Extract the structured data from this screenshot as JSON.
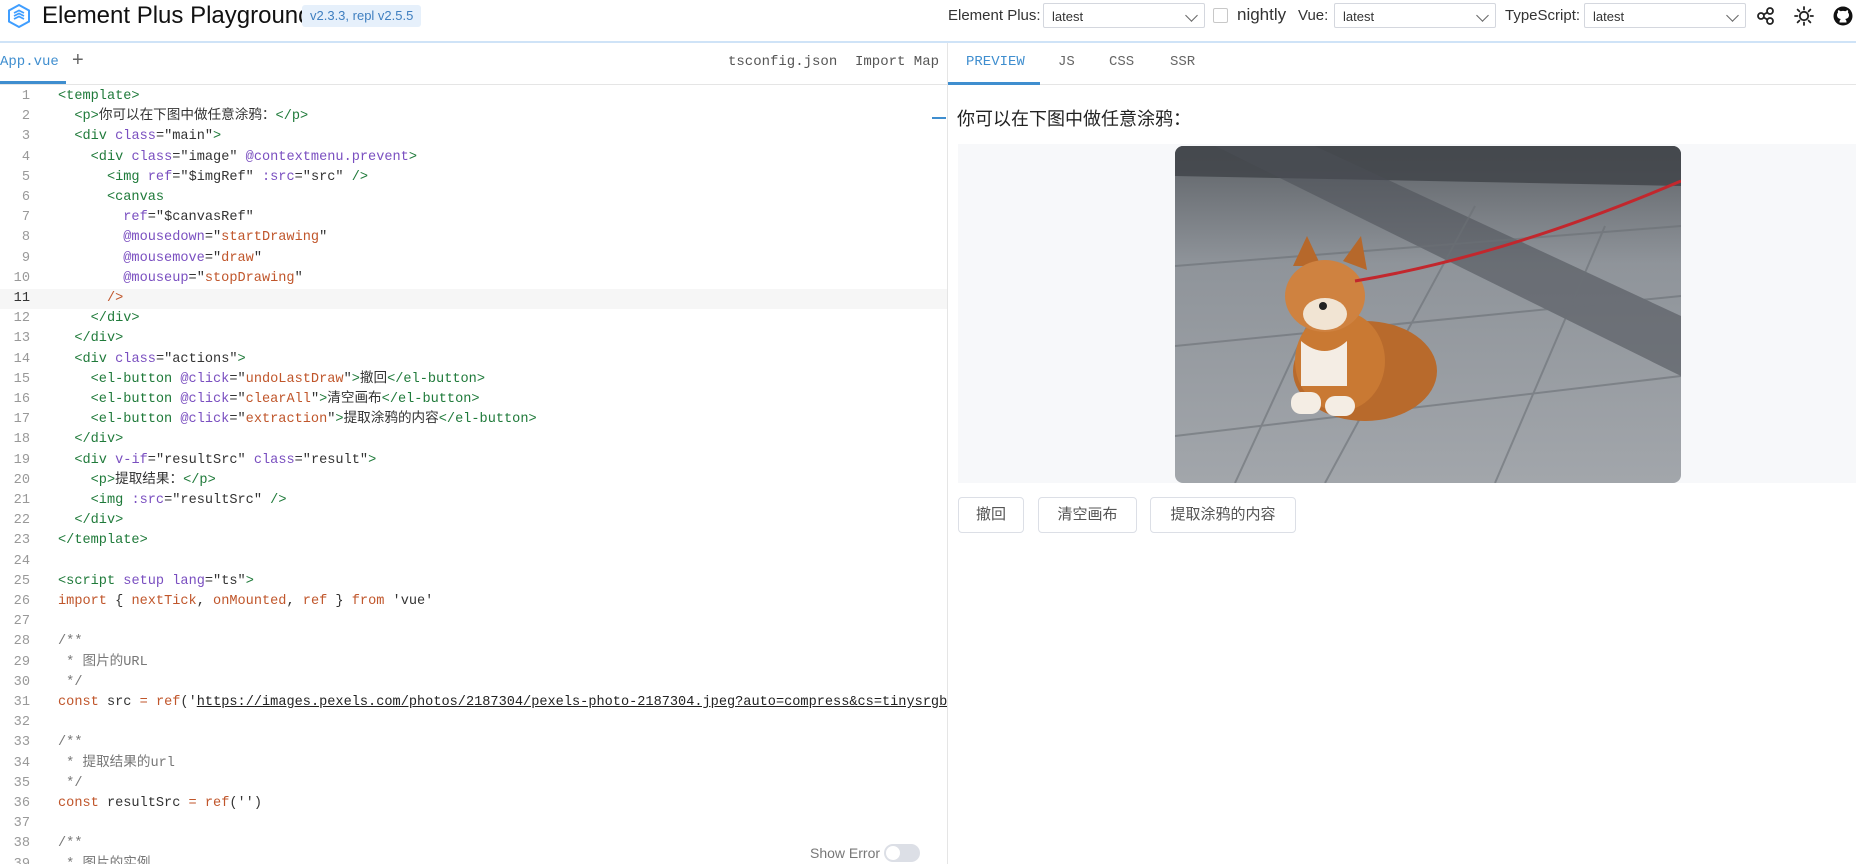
{
  "header": {
    "title": "Element Plus Playground",
    "version_badge": "v2.3.3, repl v2.5.5",
    "element_plus_label": "Element Plus:",
    "element_plus_value": "latest",
    "nightly_label": "nightly",
    "vue_label": "Vue:",
    "vue_value": "latest",
    "typescript_label": "TypeScript:",
    "typescript_value": "latest",
    "icons": [
      "share-icon",
      "sun-icon",
      "github-icon"
    ]
  },
  "editor_tabs": {
    "active": "App.vue",
    "add": "+",
    "right": [
      "tsconfig.json",
      "Import Map"
    ]
  },
  "preview_tabs": [
    "PREVIEW",
    "JS",
    "CSS",
    "SSR"
  ],
  "editor": {
    "active_line": 11,
    "lines": [
      {
        "n": "1",
        "segs": [
          [
            "tag",
            "<template>"
          ]
        ]
      },
      {
        "n": "2",
        "segs": [
          [
            "txt",
            "  "
          ],
          [
            "tag",
            "<p>"
          ],
          [
            "txt",
            "你可以在下图中做任意涂鸦："
          ],
          [
            "tag",
            "</p>"
          ]
        ]
      },
      {
        "n": "3",
        "segs": [
          [
            "txt",
            "  "
          ],
          [
            "tag",
            "<div"
          ],
          [
            "txt",
            " "
          ],
          [
            "attr",
            "class"
          ],
          [
            "txt",
            "=\"main\""
          ],
          [
            "tag",
            ">"
          ]
        ]
      },
      {
        "n": "4",
        "segs": [
          [
            "txt",
            "    "
          ],
          [
            "tag",
            "<div"
          ],
          [
            "txt",
            " "
          ],
          [
            "attr",
            "class"
          ],
          [
            "txt",
            "=\"image\" "
          ],
          [
            "attr",
            "@contextmenu.prevent"
          ],
          [
            "tag",
            ">"
          ]
        ]
      },
      {
        "n": "5",
        "segs": [
          [
            "txt",
            "      "
          ],
          [
            "tag",
            "<img"
          ],
          [
            "txt",
            " "
          ],
          [
            "attr",
            "ref"
          ],
          [
            "txt",
            "=\"$imgRef\" "
          ],
          [
            "attr",
            ":src"
          ],
          [
            "txt",
            "=\"src\" "
          ],
          [
            "tag",
            "/>"
          ]
        ]
      },
      {
        "n": "6",
        "segs": [
          [
            "txt",
            "      "
          ],
          [
            "tag",
            "<canvas"
          ]
        ]
      },
      {
        "n": "7",
        "segs": [
          [
            "txt",
            "        "
          ],
          [
            "attr",
            "ref"
          ],
          [
            "txt",
            "=\"$canvasRef\""
          ]
        ]
      },
      {
        "n": "8",
        "segs": [
          [
            "txt",
            "        "
          ],
          [
            "attr",
            "@mousedown"
          ],
          [
            "txt",
            "=\""
          ],
          [
            "str",
            "startDrawing"
          ],
          [
            "txt",
            "\""
          ]
        ]
      },
      {
        "n": "9",
        "segs": [
          [
            "txt",
            "        "
          ],
          [
            "attr",
            "@mousemove"
          ],
          [
            "txt",
            "=\""
          ],
          [
            "str",
            "draw"
          ],
          [
            "txt",
            "\""
          ]
        ]
      },
      {
        "n": "10",
        "segs": [
          [
            "txt",
            "        "
          ],
          [
            "attr",
            "@mouseup"
          ],
          [
            "txt",
            "=\""
          ],
          [
            "str",
            "stopDrawing"
          ],
          [
            "txt",
            "\""
          ]
        ]
      },
      {
        "n": "11",
        "segs": [
          [
            "txt",
            "      "
          ],
          [
            "str",
            "/>"
          ]
        ]
      },
      {
        "n": "12",
        "segs": [
          [
            "txt",
            "    "
          ],
          [
            "tag",
            "</div>"
          ]
        ]
      },
      {
        "n": "13",
        "segs": [
          [
            "txt",
            "  "
          ],
          [
            "tag",
            "</div>"
          ]
        ]
      },
      {
        "n": "14",
        "segs": [
          [
            "txt",
            "  "
          ],
          [
            "tag",
            "<div"
          ],
          [
            "txt",
            " "
          ],
          [
            "attr",
            "class"
          ],
          [
            "txt",
            "=\"actions\""
          ],
          [
            "tag",
            ">"
          ]
        ]
      },
      {
        "n": "15",
        "segs": [
          [
            "txt",
            "    "
          ],
          [
            "tag",
            "<el-button"
          ],
          [
            "txt",
            " "
          ],
          [
            "attr",
            "@click"
          ],
          [
            "txt",
            "=\""
          ],
          [
            "str",
            "undoLastDraw"
          ],
          [
            "txt",
            "\""
          ],
          [
            "tag",
            ">"
          ],
          [
            "txt",
            "撤回"
          ],
          [
            "tag",
            "</el-button>"
          ]
        ]
      },
      {
        "n": "16",
        "segs": [
          [
            "txt",
            "    "
          ],
          [
            "tag",
            "<el-button"
          ],
          [
            "txt",
            " "
          ],
          [
            "attr",
            "@click"
          ],
          [
            "txt",
            "=\""
          ],
          [
            "str",
            "clearAll"
          ],
          [
            "txt",
            "\""
          ],
          [
            "tag",
            ">"
          ],
          [
            "txt",
            "清空画布"
          ],
          [
            "tag",
            "</el-button>"
          ]
        ]
      },
      {
        "n": "17",
        "segs": [
          [
            "txt",
            "    "
          ],
          [
            "tag",
            "<el-button"
          ],
          [
            "txt",
            " "
          ],
          [
            "attr",
            "@click"
          ],
          [
            "txt",
            "=\""
          ],
          [
            "str",
            "extraction"
          ],
          [
            "txt",
            "\""
          ],
          [
            "tag",
            ">"
          ],
          [
            "txt",
            "提取涂鸦的内容"
          ],
          [
            "tag",
            "</el-button>"
          ]
        ]
      },
      {
        "n": "18",
        "segs": [
          [
            "txt",
            "  "
          ],
          [
            "tag",
            "</div>"
          ]
        ]
      },
      {
        "n": "19",
        "segs": [
          [
            "txt",
            "  "
          ],
          [
            "tag",
            "<div"
          ],
          [
            "txt",
            " "
          ],
          [
            "attr",
            "v-if"
          ],
          [
            "txt",
            "=\"resultSrc\" "
          ],
          [
            "attr",
            "class"
          ],
          [
            "txt",
            "=\"result\""
          ],
          [
            "tag",
            ">"
          ]
        ]
      },
      {
        "n": "20",
        "segs": [
          [
            "txt",
            "    "
          ],
          [
            "tag",
            "<p>"
          ],
          [
            "txt",
            "提取结果："
          ],
          [
            "tag",
            "</p>"
          ]
        ]
      },
      {
        "n": "21",
        "segs": [
          [
            "txt",
            "    "
          ],
          [
            "tag",
            "<img"
          ],
          [
            "txt",
            " "
          ],
          [
            "attr",
            ":src"
          ],
          [
            "txt",
            "=\"resultSrc\" "
          ],
          [
            "tag",
            "/>"
          ]
        ]
      },
      {
        "n": "22",
        "segs": [
          [
            "txt",
            "  "
          ],
          [
            "tag",
            "</div>"
          ]
        ]
      },
      {
        "n": "23",
        "segs": [
          [
            "tag",
            "</template>"
          ]
        ]
      },
      {
        "n": "24",
        "segs": []
      },
      {
        "n": "25",
        "segs": [
          [
            "tag",
            "<script"
          ],
          [
            "txt",
            " "
          ],
          [
            "attr",
            "setup"
          ],
          [
            "txt",
            " "
          ],
          [
            "attr",
            "lang"
          ],
          [
            "txt",
            "=\"ts\""
          ],
          [
            "tag",
            ">"
          ]
        ]
      },
      {
        "n": "26",
        "segs": [
          [
            "kw",
            "import"
          ],
          [
            "txt",
            " { "
          ],
          [
            "fn",
            "nextTick"
          ],
          [
            "txt",
            ", "
          ],
          [
            "fn",
            "onMounted"
          ],
          [
            "txt",
            ", "
          ],
          [
            "fn",
            "ref"
          ],
          [
            "txt",
            " } "
          ],
          [
            "kw",
            "from"
          ],
          [
            "txt",
            " 'vue'"
          ]
        ]
      },
      {
        "n": "27",
        "segs": []
      },
      {
        "n": "28",
        "segs": [
          [
            "com",
            "/**"
          ]
        ]
      },
      {
        "n": "29",
        "segs": [
          [
            "com",
            " * 图片的URL"
          ]
        ]
      },
      {
        "n": "30",
        "segs": [
          [
            "com",
            " */"
          ]
        ]
      },
      {
        "n": "31",
        "segs": [
          [
            "kw",
            "const"
          ],
          [
            "txt",
            " src "
          ],
          [
            "kw",
            "="
          ],
          [
            "txt",
            " "
          ],
          [
            "fn",
            "ref"
          ],
          [
            "txt",
            "('"
          ],
          [
            "url",
            "https://images.pexels.com/photos/2187304/pexels-photo-2187304.jpeg?auto=compress&cs=tinysrgb&w"
          ]
        ]
      },
      {
        "n": "32",
        "segs": []
      },
      {
        "n": "33",
        "segs": [
          [
            "com",
            "/**"
          ]
        ]
      },
      {
        "n": "34",
        "segs": [
          [
            "com",
            " * 提取结果的url"
          ]
        ]
      },
      {
        "n": "35",
        "segs": [
          [
            "com",
            " */"
          ]
        ]
      },
      {
        "n": "36",
        "segs": [
          [
            "kw",
            "const"
          ],
          [
            "txt",
            " resultSrc "
          ],
          [
            "kw",
            "="
          ],
          [
            "txt",
            " "
          ],
          [
            "fn",
            "ref"
          ],
          [
            "txt",
            "('')"
          ]
        ]
      },
      {
        "n": "37",
        "segs": []
      },
      {
        "n": "38",
        "segs": [
          [
            "com",
            "/**"
          ]
        ]
      },
      {
        "n": "39",
        "segs": [
          [
            "com",
            " * 图片的实例"
          ]
        ]
      }
    ]
  },
  "show_error_label": "Show Error",
  "preview": {
    "text": "你可以在下图中做任意涂鸦：",
    "buttons": [
      "撤回",
      "清空画布",
      "提取涂鸦的内容"
    ]
  }
}
